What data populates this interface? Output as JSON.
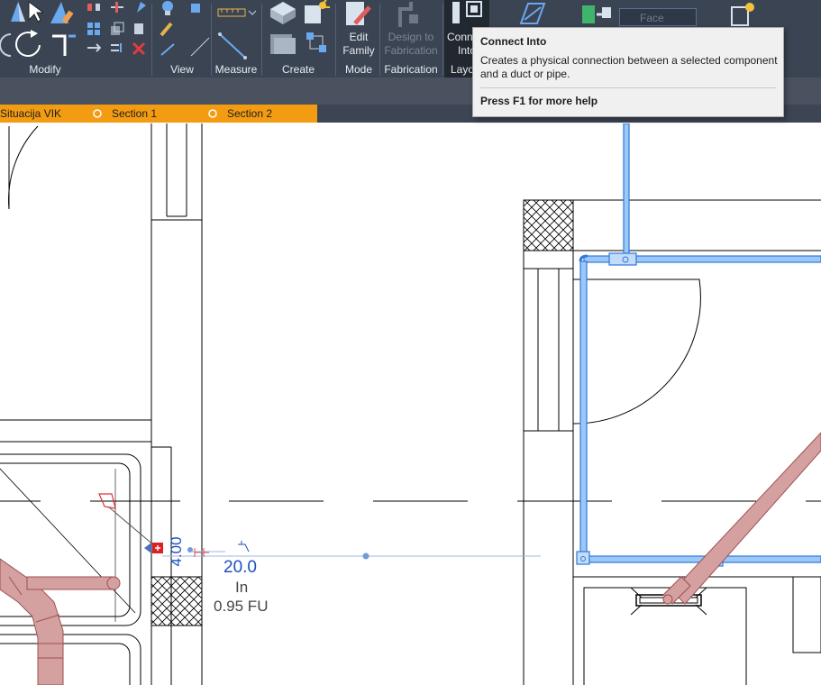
{
  "ribbon": {
    "panels": {
      "modify": "Modify",
      "view": "View",
      "measure": "Measure",
      "create": "Create",
      "mode": "Mode",
      "fabrication": "Fabrication",
      "layout_partial": "Layo"
    },
    "buttons": {
      "edit_family": [
        "Edit",
        "Family"
      ],
      "design_to_fabrication": [
        "Design to",
        "Fabrication"
      ],
      "connect_into": [
        "Conn",
        "Into"
      ]
    },
    "face_placeholder": "Face"
  },
  "tooltip": {
    "title": "Connect Into",
    "description": "Creates a physical connection between a selected component and a duct or pipe.",
    "help": "Press F1 for more help"
  },
  "tabs": [
    {
      "label": "Situacija VIK"
    },
    {
      "label": "Section 1"
    },
    {
      "label": "Section 2"
    }
  ],
  "drawing": {
    "rotated_tag": "4.00",
    "tag_value": "20.0",
    "tag_unit": "In",
    "tag_fu": "0.95 FU"
  },
  "colors": {
    "ribbon_bg": "#3b4453",
    "tab_orange": "#f39c12",
    "pipe_blue": "#7db3f0",
    "pipe_red": "#c98a8a",
    "tag_blue": "#1f4fbf"
  }
}
